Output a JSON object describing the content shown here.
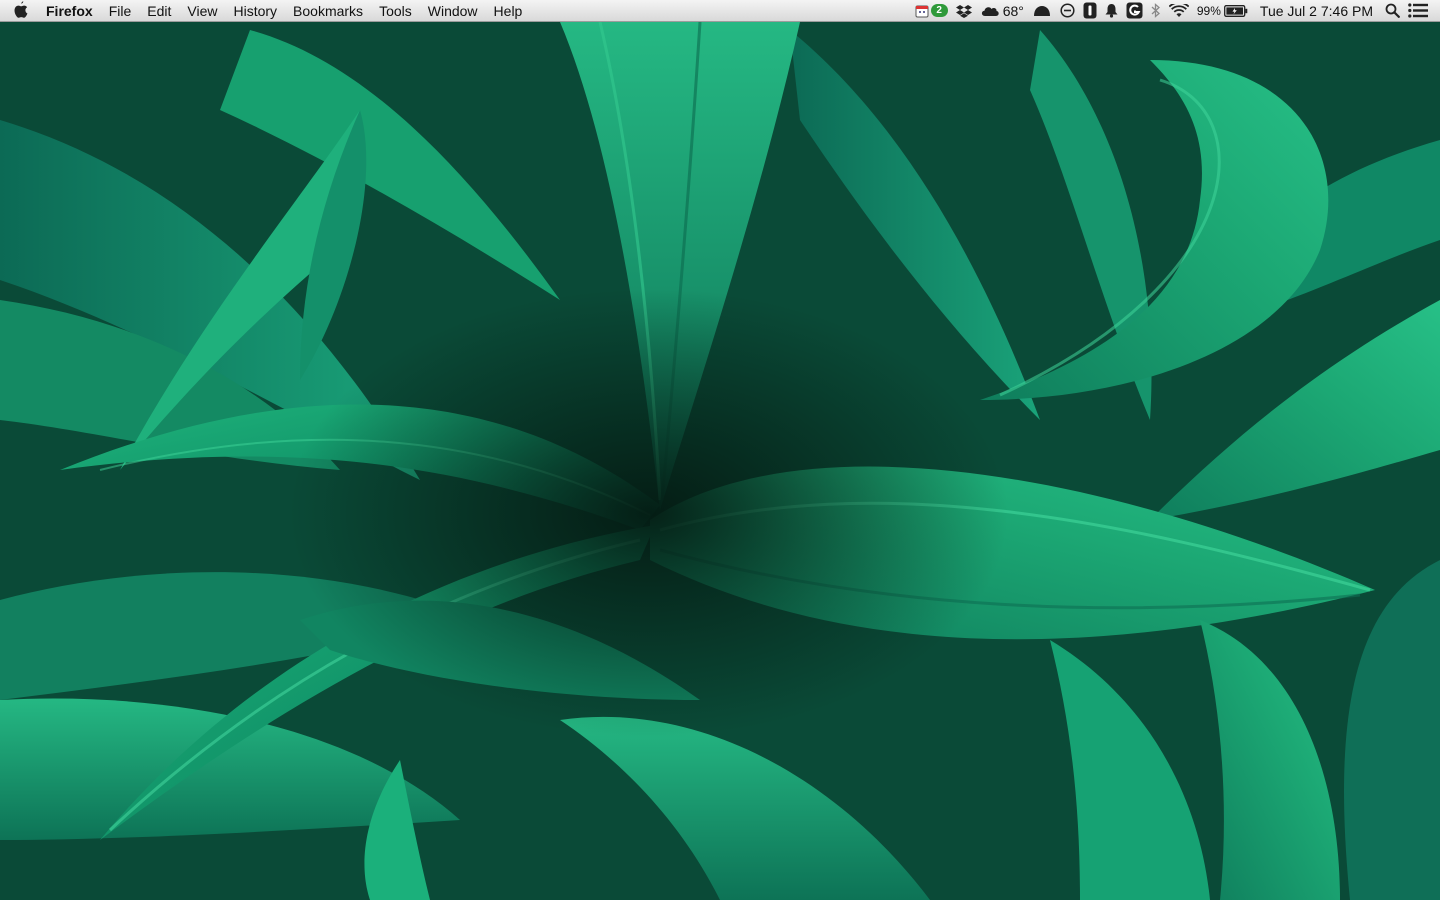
{
  "menubar": {
    "apple_icon": "apple-logo-icon",
    "app_name": "Firefox",
    "menus": [
      "File",
      "Edit",
      "View",
      "History",
      "Bookmarks",
      "Tools",
      "Window",
      "Help"
    ]
  },
  "status": {
    "notification_badge": "2",
    "weather_temp": "68°",
    "battery_percent": "99%",
    "clock": "Tue Jul 2  7:46 PM",
    "icons": [
      "calendar-icon",
      "dropbox-icon",
      "weather-cloud-icon",
      "cloud-app-icon",
      "do-not-disturb-icon",
      "app-number-icon",
      "notification-bell-icon",
      "growl-icon",
      "bluetooth-icon",
      "wifi-icon",
      "battery-icon",
      "spotlight-search-icon",
      "notification-center-icon"
    ]
  },
  "colors": {
    "menubar_top": "#f4f4f4",
    "menubar_bottom": "#d9d9d9",
    "leaf_light": "#22b37a",
    "leaf_mid": "#159a66",
    "leaf_dark": "#0a5a45",
    "background_shadow": "#0b3a2c"
  },
  "desktop": {
    "wallpaper": "green-leaves-wallpaper"
  }
}
